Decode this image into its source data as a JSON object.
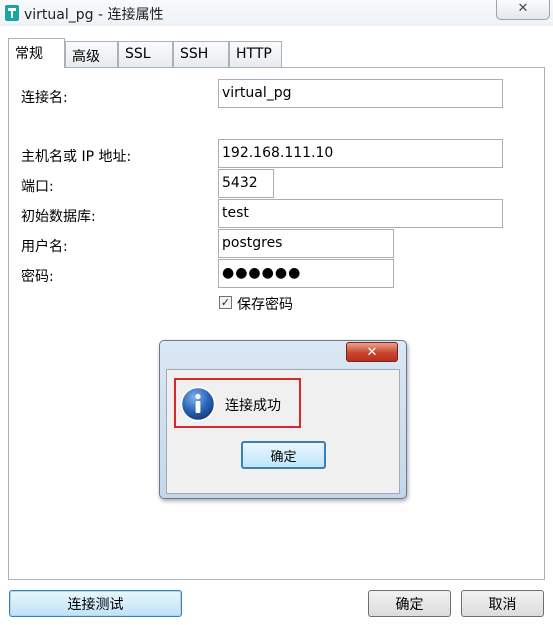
{
  "window": {
    "title": "virtual_pg - 连接属性",
    "close_glyph": "✕"
  },
  "tabs": [
    "常规",
    "高级",
    "SSL",
    "SSH",
    "HTTP"
  ],
  "form": {
    "conn_name_label": "连接名:",
    "conn_name_value": "virtual_pg",
    "host_label": "主机名或 IP 地址:",
    "host_value": "192.168.111.10",
    "port_label": "端口:",
    "port_value": "5432",
    "db_label": "初始数据库:",
    "db_value": "test",
    "user_label": "用户名:",
    "user_value": "postgres",
    "pwd_label": "密码:",
    "pwd_value": "●●●●●●",
    "save_pwd_label": "保存密码",
    "save_pwd_checked": true
  },
  "dialog": {
    "close_glyph": "✕",
    "message": "连接成功",
    "ok_label": "确定",
    "icon": "info-icon"
  },
  "buttons": {
    "test_label": "连接测试",
    "ok_label": "确定",
    "cancel_label": "取消"
  },
  "colors": {
    "highlight": "#d9262c",
    "focus": "#3c7fb1"
  }
}
